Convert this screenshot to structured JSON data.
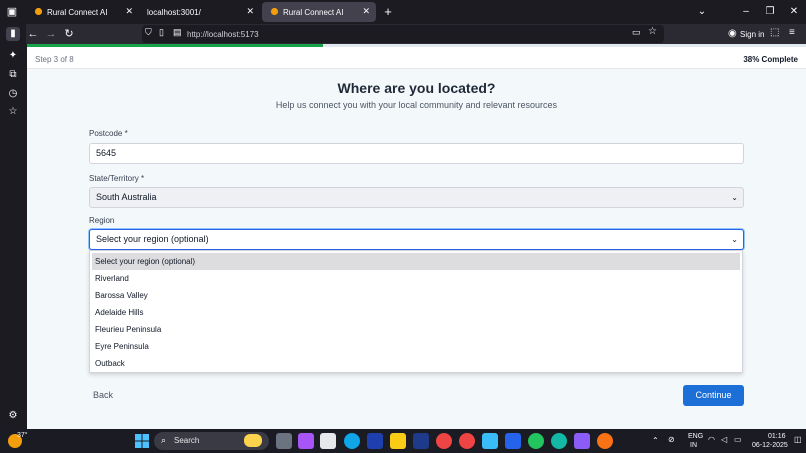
{
  "browser": {
    "tabs": [
      {
        "title": "Rural Connect AI",
        "active": false
      },
      {
        "title": "localhost:3001/",
        "active": false
      },
      {
        "title": "Rural Connect AI",
        "active": true
      }
    ],
    "url": "http://localhost:5173",
    "signin_label": "Sign in"
  },
  "progress": {
    "step_text": "Step 3 of 8",
    "percent_text": "38% Complete",
    "fraction": 0.38
  },
  "form": {
    "title": "Where are you located?",
    "subtitle": "Help us connect you with your local community and relevant resources",
    "postcode_label": "Postcode *",
    "postcode_value": "5645",
    "state_label": "State/Territory *",
    "state_value": "South Australia",
    "region_label": "Region",
    "region_value": "Select your region (optional)",
    "region_options": [
      "Select your region (optional)",
      "Riverland",
      "Barossa Valley",
      "Adelaide Hills",
      "Fleurieu Peninsula",
      "Eyre Peninsula",
      "Outback"
    ],
    "back_label": "Back",
    "continue_label": "Continue"
  },
  "taskbar": {
    "weather": "37°",
    "search_label": "Search",
    "lang_top": "ENG",
    "lang_bottom": "IN",
    "time": "01:16",
    "date": "06-12-2025"
  },
  "colors": {
    "accent": "#1d6fd8",
    "progress": "#16a34a"
  }
}
